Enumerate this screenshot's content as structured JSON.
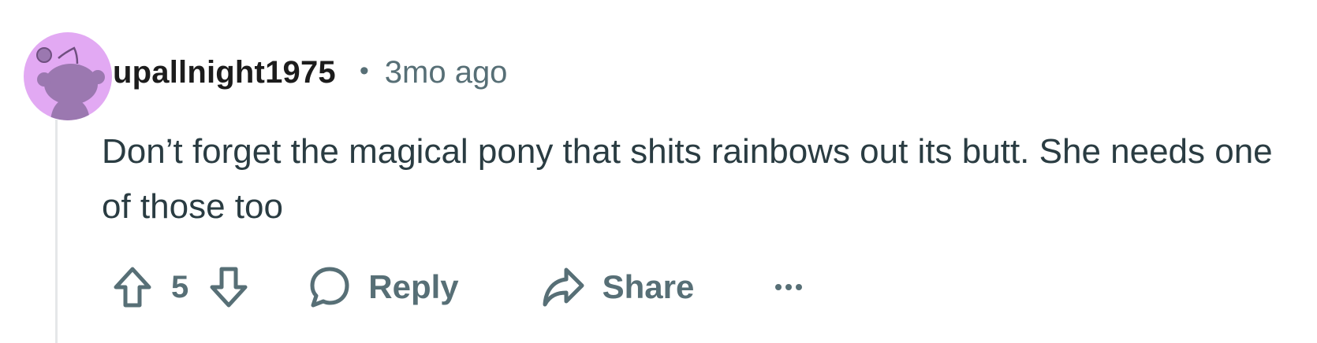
{
  "comment": {
    "username": "upallnight1975",
    "separator": "•",
    "timestamp": "3mo ago",
    "text": "Don’t forget the magical pony that shits rainbows out its butt. She needs one of those too",
    "avatar": {
      "background": "#e2a9f3",
      "figure_color": "#9b78b0",
      "icon": "snoo-avatar-icon"
    }
  },
  "actions": {
    "vote_count": "5",
    "reply_label": "Reply",
    "share_label": "Share",
    "more_label": "···",
    "icon_color": "#576f76"
  },
  "colors": {
    "username": "#1c1c1c",
    "meta": "#576f76",
    "body_text": "#2a3c42",
    "thread_line": "#e5e7e9"
  }
}
